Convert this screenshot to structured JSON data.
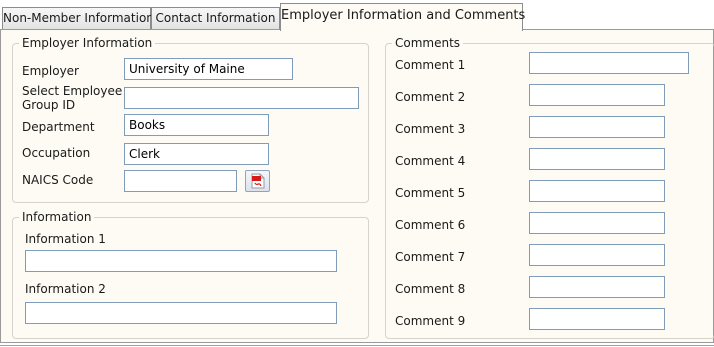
{
  "tabs": [
    {
      "label": "Non-Member Information"
    },
    {
      "label": "Contact Information"
    },
    {
      "label": "Employer Information and Comments"
    }
  ],
  "employer_section": {
    "legend": "Employer Information",
    "employer_label": "Employer",
    "employer_value": "University of Maine",
    "group_id_label": "Select Employee Group ID",
    "group_id_value": "",
    "department_label": "Department",
    "department_value": "Books",
    "occupation_label": "Occupation",
    "occupation_value": "Clerk",
    "naics_label": "NAICS Code",
    "naics_value": "",
    "naics_lookup_icon": "pdf-document-icon"
  },
  "information_section": {
    "legend": "Information",
    "info1_label": "Information 1",
    "info1_value": "",
    "info2_label": "Information 2",
    "info2_value": ""
  },
  "comments_section": {
    "legend": "Comments",
    "items": [
      {
        "label": "Comment 1",
        "value": ""
      },
      {
        "label": "Comment 2",
        "value": ""
      },
      {
        "label": "Comment 3",
        "value": ""
      },
      {
        "label": "Comment 4",
        "value": ""
      },
      {
        "label": "Comment 5",
        "value": ""
      },
      {
        "label": "Comment 6",
        "value": ""
      },
      {
        "label": "Comment 7",
        "value": ""
      },
      {
        "label": "Comment 8",
        "value": ""
      },
      {
        "label": "Comment 9",
        "value": ""
      }
    ]
  }
}
